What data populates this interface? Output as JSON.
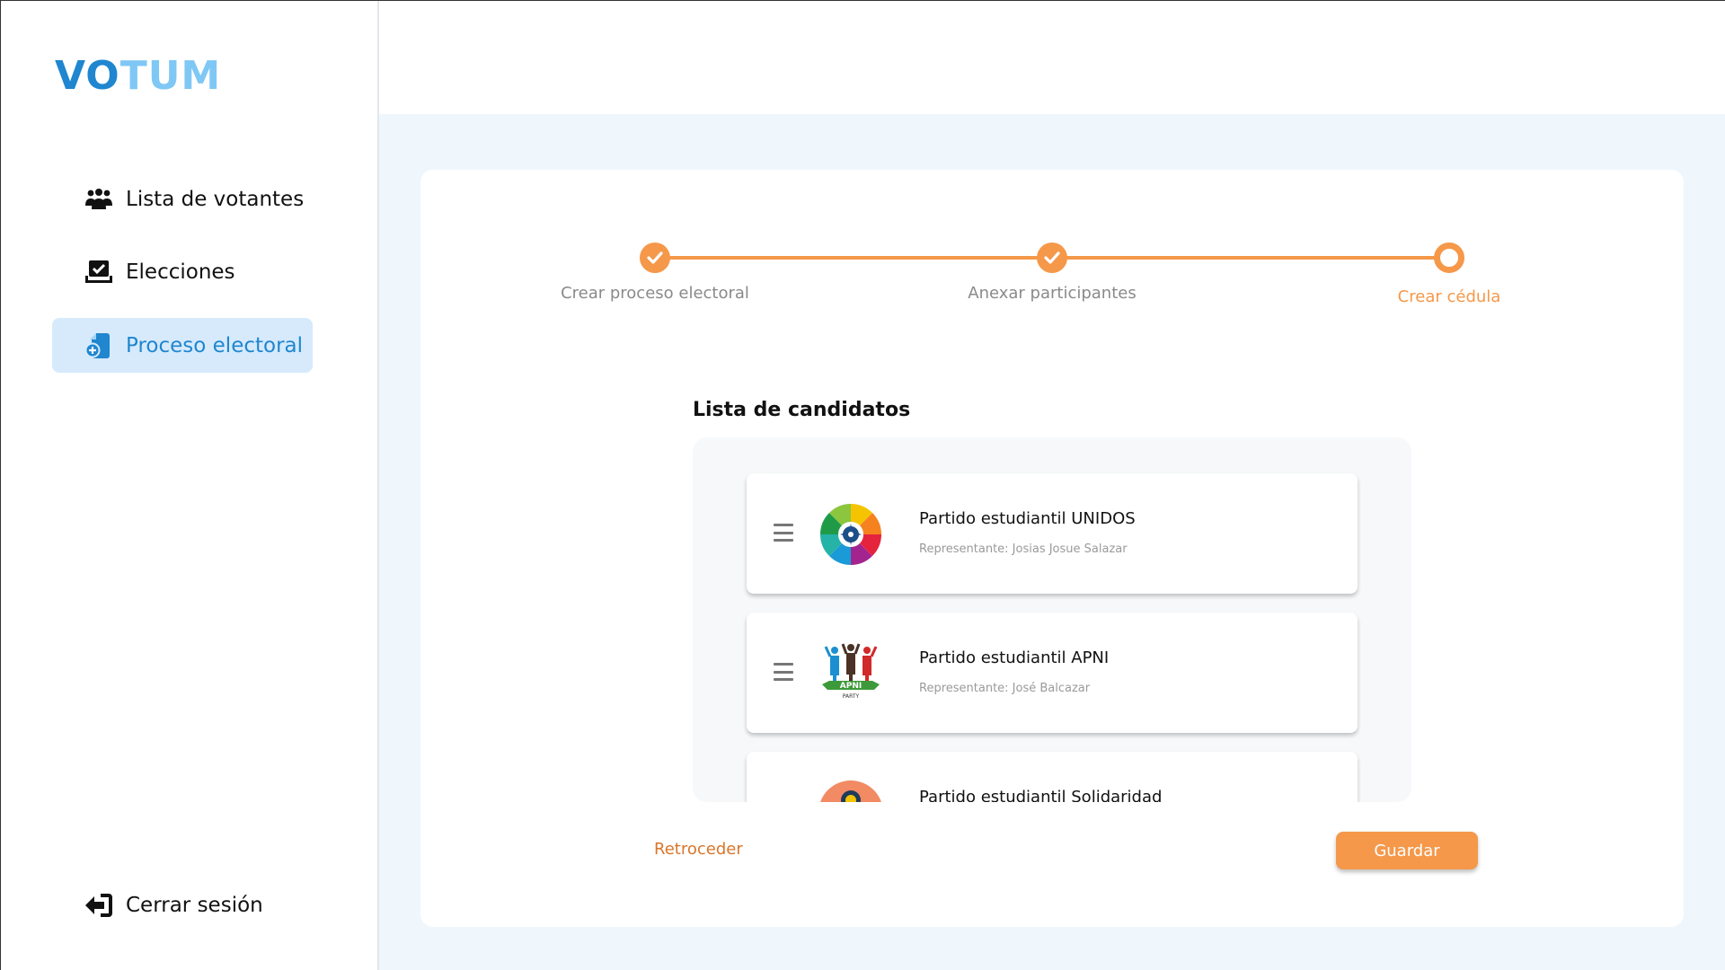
{
  "app": {
    "logo_part1": "VO",
    "logo_part2": "TUM"
  },
  "sidebar": {
    "items": [
      {
        "label": "Lista de votantes",
        "icon": "users-group-icon"
      },
      {
        "label": "Elecciones",
        "icon": "ballot-check-icon"
      },
      {
        "label": "Proceso electoral",
        "icon": "document-add-icon",
        "active": true
      }
    ],
    "logout_label": "Cerrar sesión"
  },
  "stepper": {
    "steps": [
      {
        "label": "Crear proceso electoral",
        "state": "done"
      },
      {
        "label": "Anexar participantes",
        "state": "done"
      },
      {
        "label": "Crear cédula",
        "state": "current"
      }
    ]
  },
  "candidates": {
    "title": "Lista de candidatos",
    "items": [
      {
        "name": "Partido estudiantil UNIDOS",
        "representative": "Representante: Josias Josue Salazar",
        "logo": "unidos-logo"
      },
      {
        "name": "Partido estudiantil APNI",
        "representative": "Representante: José Balcazar",
        "logo": "apni-logo",
        "logo_text": "APNI",
        "logo_subtext": "PARTY"
      },
      {
        "name": "Partido estudiantil Solidaridad",
        "representative": "",
        "logo": "solidaridad-logo"
      }
    ]
  },
  "actions": {
    "back_label": "Retroceder",
    "save_label": "Guardar"
  },
  "colors": {
    "accent": "#f5984a",
    "brand_dark": "#1f86cf",
    "brand_light": "#7fc8f5",
    "active_nav_bg": "#d6eafc"
  }
}
